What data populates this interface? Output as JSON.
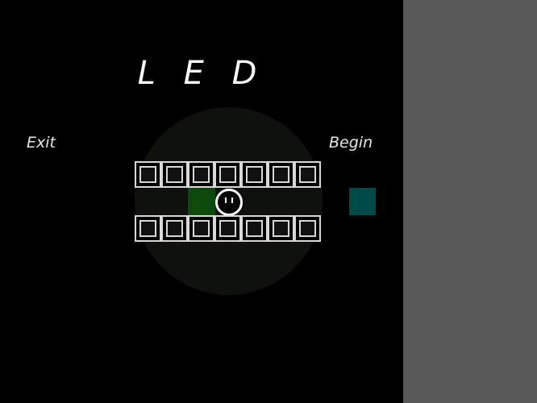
{
  "game": {
    "title": "L E D",
    "menu": {
      "exit_label": "Exit",
      "begin_label": "Begin"
    },
    "grid": {
      "columns": 7,
      "top_row_cells": 7,
      "bottom_row_cells": 7
    },
    "colors": {
      "background": "#000000",
      "side_panel": "#595959",
      "cell_border": "#d8d8d8",
      "lit_tile": "#0e4a0e",
      "goal_tile": "#004a4a",
      "player": "#ffffff"
    },
    "icons": {
      "player": "smiley-face-icon"
    }
  }
}
